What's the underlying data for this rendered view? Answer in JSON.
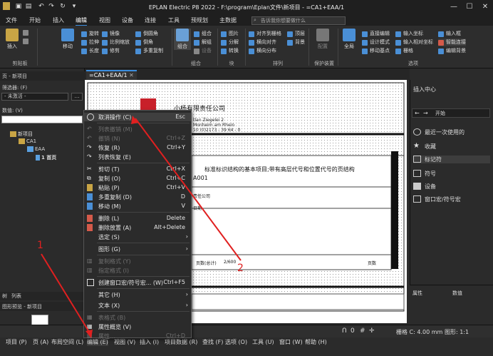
{
  "titlebar": {
    "title": "EPLAN Electric P8 2022 - F:\\program\\Eplan文件\\新项目 - =CA1+EAA/1",
    "quick_access": [
      "file-icon",
      "open-icon",
      "save-icon",
      "undo-icon",
      "redo-icon",
      "refresh-icon",
      "dropdown-icon"
    ],
    "window_controls": [
      "minimize",
      "maximize",
      "close"
    ]
  },
  "menu_tabs": [
    "文件",
    "开始",
    "插入",
    "编辑",
    "视图",
    "设备",
    "连接",
    "工具",
    "预规划",
    "主数据"
  ],
  "active_tab": "编辑",
  "search_placeholder": "告诉我你想要做什么",
  "ribbon": {
    "clipboard": {
      "paste": "插入",
      "label": "剪贴板"
    },
    "move": "移动",
    "small_a": [
      "旋转",
      "拉伸",
      "长度"
    ],
    "small_b": [
      "镜像",
      "比例缩放",
      "修剪"
    ],
    "small_c": [
      "倒圆角",
      "倒角",
      "多重复制"
    ],
    "group": "组合",
    "small_d": [
      "组合",
      "解组"
    ],
    "group_label": "组合",
    "block_small": [
      "图片",
      "分解",
      "转换"
    ],
    "block_label": "块",
    "arrange_small": [
      "对齐到栅格",
      "横向对齐",
      "横向分布"
    ],
    "arrange_small2": [
      "顶层",
      "背景"
    ],
    "arrange_label": "排列",
    "protect": "配置",
    "protect_label": "保护装置",
    "global": "全局",
    "options_small": [
      "直接编辑",
      "设计模式",
      "移动基点"
    ],
    "options_small2": [
      "输入坐标",
      "输入相对坐标",
      "栅格"
    ],
    "options_small3": [
      "输入框",
      "智能连接",
      "编辑背景"
    ],
    "options_label": "选项"
  },
  "left_panel": {
    "header": "页 - 新项目",
    "filter_label": "筛选器: (F)",
    "filter_value": "- 未激活 -",
    "value_label": "数值: (V)",
    "tree": [
      {
        "label": "新项目",
        "level": 0
      },
      {
        "label": "CA1",
        "level": 1
      },
      {
        "label": "EAA",
        "level": 2
      },
      {
        "label": "1 首页",
        "level": 3
      }
    ],
    "tabs": [
      "树",
      "列表"
    ],
    "preview_header": "图形预览 - 新项目"
  },
  "document_tab": "=CA1+EAA/1",
  "canvas": {
    "company": "小杨有限责任公司",
    "address_lines": [
      "tlan Ziegelei 2",
      "Monheim am Rhein",
      "10 (0)2173 - 39 64 - 0"
    ],
    "heading": "标准标识结构的基本项目;带有高层代号和位置代号的页结构",
    "code": "A001",
    "company_small": "责任公司",
    "date_field": "日期",
    "page_label": "页数(总计)",
    "page_value": "2/600",
    "page_ref": "页数"
  },
  "context_menu": {
    "items": [
      {
        "label": "取消操作 (C)",
        "shortcut": "Esc",
        "icon": "cancel-icon",
        "enabled": true,
        "hover": true
      },
      {
        "label": "列表撤销 (M)",
        "shortcut": "",
        "icon": "undo-list-icon",
        "enabled": false
      },
      {
        "label": "撤销 (N)",
        "shortcut": "Ctrl+Z",
        "icon": "undo-icon",
        "enabled": false
      },
      {
        "label": "恢复 (R)",
        "shortcut": "Ctrl+Y",
        "icon": "redo-icon",
        "enabled": true
      },
      {
        "label": "列表恢复 (E)",
        "shortcut": "",
        "icon": "redo-list-icon",
        "enabled": true
      },
      {
        "label": "剪切 (T)",
        "shortcut": "Ctrl+X",
        "icon": "cut-icon",
        "enabled": true
      },
      {
        "label": "复制 (O)",
        "shortcut": "Ctrl+C",
        "icon": "copy-icon",
        "enabled": true
      },
      {
        "label": "粘贴 (P)",
        "shortcut": "Ctrl+V",
        "icon": "paste-icon",
        "enabled": true
      },
      {
        "label": "多重复制 (D)",
        "shortcut": "D",
        "icon": "multi-copy-icon",
        "enabled": true
      },
      {
        "label": "移动 (M)",
        "shortcut": "V",
        "icon": "move-icon",
        "enabled": true
      },
      {
        "label": "删除 (L)",
        "shortcut": "Delete",
        "icon": "delete-icon",
        "enabled": true
      },
      {
        "label": "删除放置 (A)",
        "shortcut": "Alt+Delete",
        "icon": "delete-placement-icon",
        "enabled": true
      },
      {
        "label": "选定 (S)",
        "shortcut": "",
        "icon": "",
        "enabled": true,
        "submenu": true
      },
      {
        "label": "图形 (G)",
        "shortcut": "",
        "icon": "",
        "enabled": true,
        "submenu": true
      },
      {
        "label": "复制格式 (Y)",
        "shortcut": "",
        "icon": "copy-format-icon",
        "enabled": false
      },
      {
        "label": "指定格式 (I)",
        "shortcut": "",
        "icon": "assign-format-icon",
        "enabled": false
      },
      {
        "label": "创建窗口宏/符号宏... (W)",
        "shortcut": "Ctrl+F5",
        "icon": "macro-icon",
        "enabled": true
      },
      {
        "label": "其它 (H)",
        "shortcut": "",
        "icon": "",
        "enabled": true,
        "submenu": true
      },
      {
        "label": "文本 (X)",
        "shortcut": "",
        "icon": "",
        "enabled": true,
        "submenu": true
      },
      {
        "label": "表格式 (B)",
        "shortcut": "",
        "icon": "table-format-icon",
        "enabled": false
      },
      {
        "label": "属性概览 (V)",
        "shortcut": "",
        "icon": "properties-overview-icon",
        "enabled": true
      },
      {
        "label": "属性...",
        "shortcut": "Ctrl+D",
        "icon": "properties-icon",
        "enabled": false
      }
    ]
  },
  "right_panel": {
    "header": "插入中心",
    "breadcrumb": "开始",
    "items": [
      "最近一次使用的",
      "收藏",
      "标记符",
      "符号",
      "设备",
      "窗口宏/符号宏"
    ],
    "props_headers": [
      "属性",
      "数值"
    ]
  },
  "statusbar": {
    "grid": "栅格 C: 4.00 mm",
    "graphic": "图形: 1:1",
    "value": "0"
  },
  "bottom_menu": [
    "项目 (P)",
    "页 (A)",
    "布局空间 (L)",
    "编辑 (E)",
    "视图 (V)",
    "插入 (I)",
    "项目数据 (R)",
    "查找 (F)",
    "选项 (O)",
    "工具 (U)",
    "窗口 (W)",
    "帮助 (H)"
  ],
  "annotations": [
    "1",
    "2"
  ],
  "colors": {
    "accent": "#3c8dde",
    "annotation": "#e02020",
    "logo": "#c8202a"
  }
}
